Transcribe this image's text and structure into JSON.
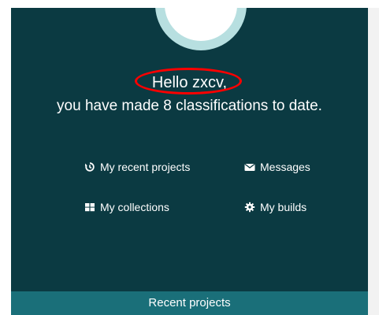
{
  "greeting": {
    "hello": "Hello zxcv,",
    "summary": "you have made 8 classifications to date."
  },
  "links": {
    "recent_projects": "My recent projects",
    "messages": "Messages",
    "collections": "My collections",
    "builds": "My builds"
  },
  "footer": {
    "recent_projects_tab": "Recent projects"
  },
  "colors": {
    "hero_bg": "#0b3a42",
    "avatar_ring": "#b7dfe0",
    "recent_bar": "#1a6f79",
    "annotation_ring": "#ff0000"
  },
  "icons": {
    "recent": "history-icon",
    "messages": "envelope-icon",
    "collections": "grid-icon",
    "builds": "gear-icon"
  }
}
